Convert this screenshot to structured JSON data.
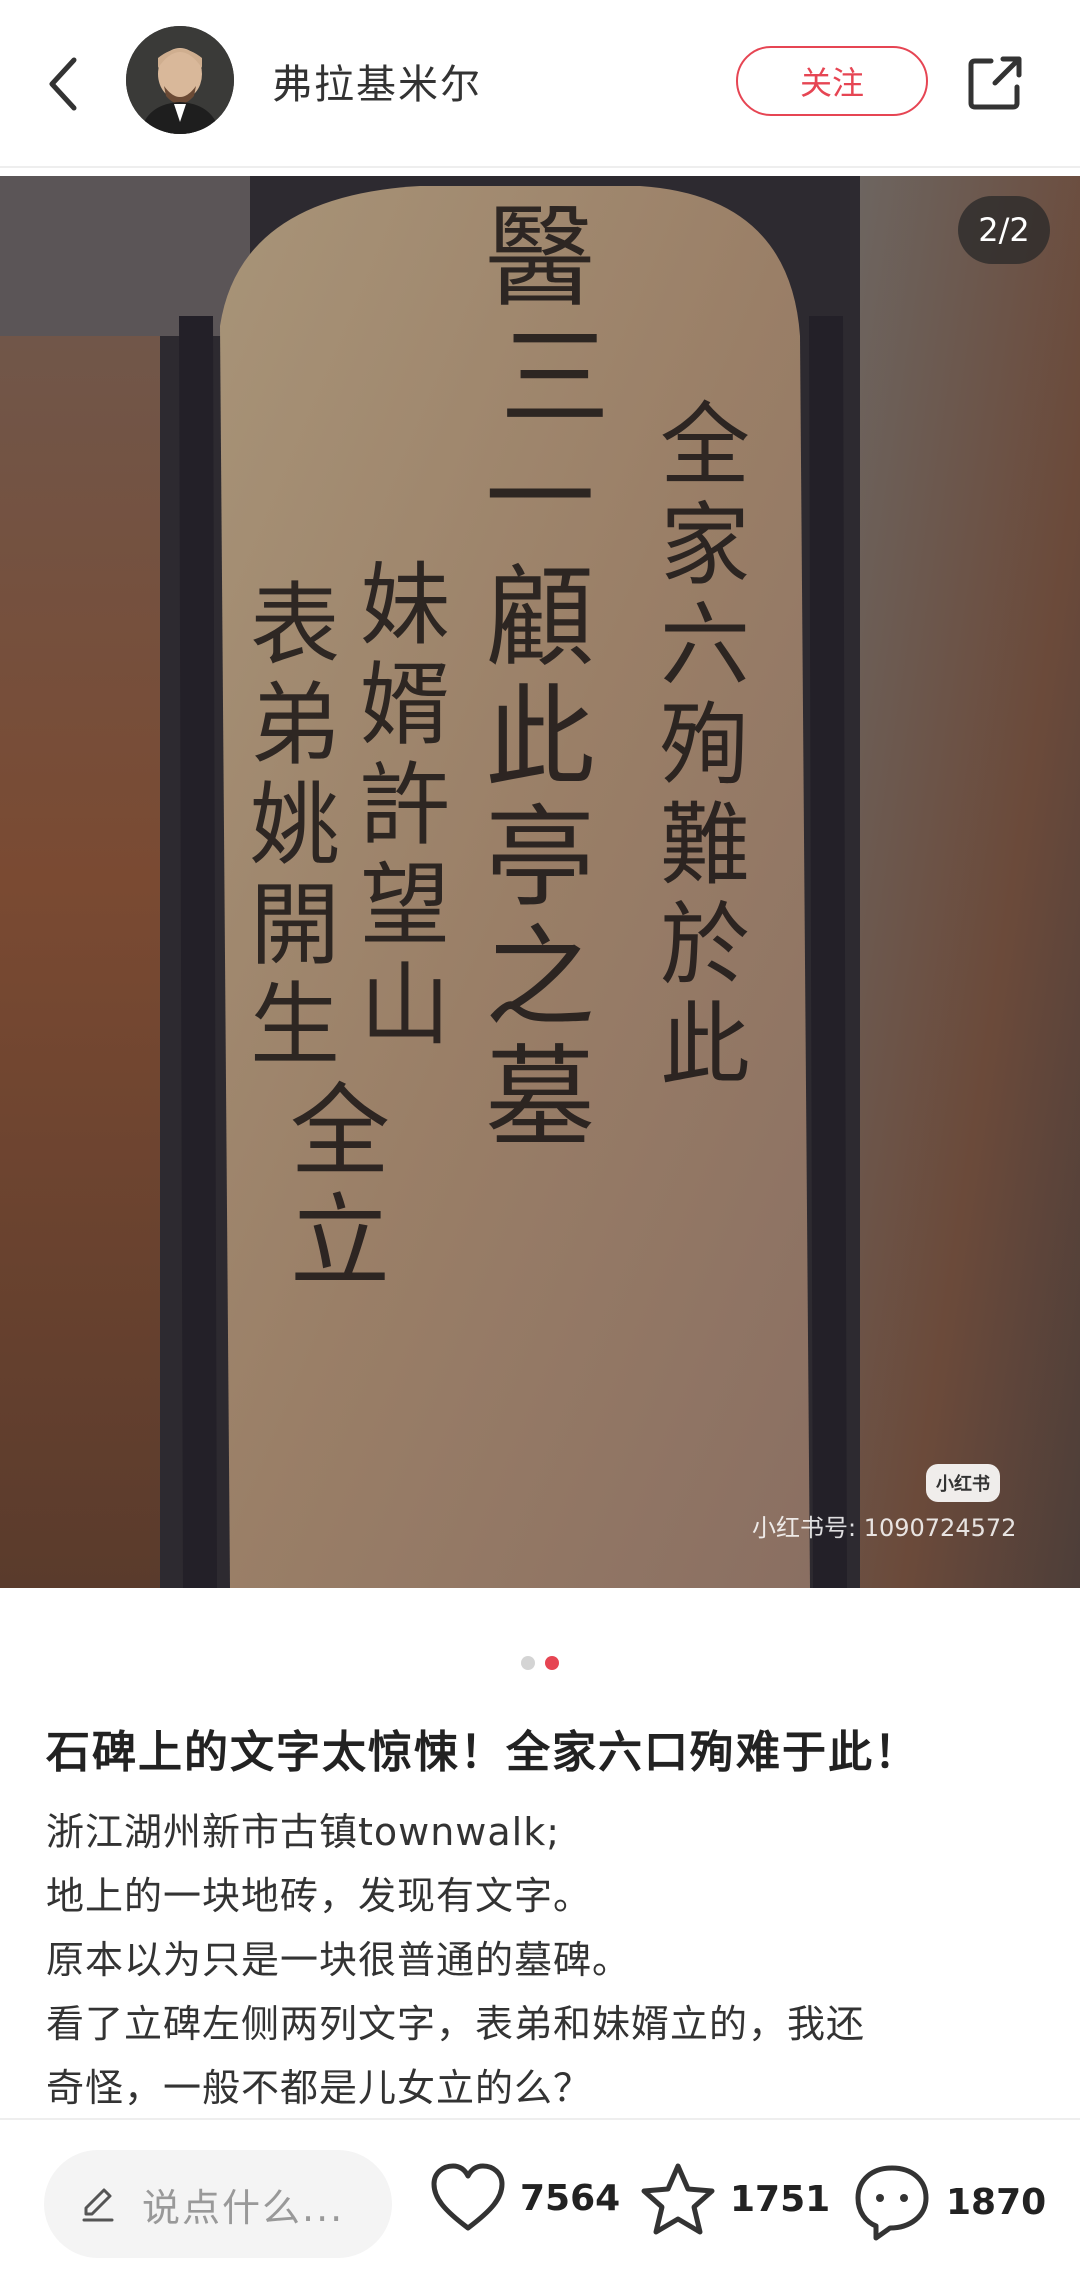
{
  "header": {
    "author_name": "弗拉基米尔",
    "follow_label": "关注"
  },
  "image": {
    "page_indicator": "2/2",
    "watermark_logo": "小红书",
    "watermark_text": "小红书号: 1090724572",
    "total_pages": 2,
    "current_page": 2
  },
  "post": {
    "title": "石碑上的文字太惊悚！全家六口殉难于此！",
    "body_lines": [
      "浙江湖州新市古镇townwalk;",
      "地上的一块地砖，发现有文字。",
      "原本以为只是一块很普通的墓碑。",
      "看了立碑左侧两列文字，表弟和妹婿立的，我还",
      "奇怪，一般不都是儿女立的么？"
    ]
  },
  "bottom_bar": {
    "comment_placeholder": "说点什么...",
    "like_count": "7564",
    "collect_count": "1751",
    "comment_count": "1870"
  },
  "colors": {
    "accent": "#e64553",
    "dot_inactive": "#d4d4d4"
  },
  "icons": {
    "back": "chevron-left-icon",
    "share": "share-icon",
    "edit": "pencil-icon",
    "like": "heart-icon",
    "collect": "star-icon",
    "comment": "chat-bubble-icon"
  }
}
